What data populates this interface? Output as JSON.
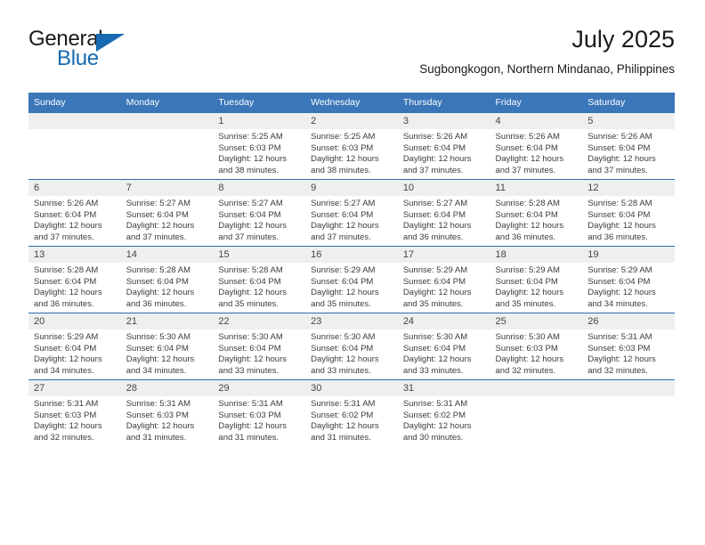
{
  "brand": {
    "name_part1": "General",
    "name_part2": "Blue",
    "logo_icon": "triangle-flag-icon"
  },
  "header": {
    "title": "July 2025",
    "subtitle": "Sugbongkogon, Northern Mindanao, Philippines"
  },
  "colors": {
    "header_blue": "#3a76b8",
    "row_divider_blue": "#2f6cb0",
    "date_band_gray": "#efefef",
    "brand_blue": "#1769b0",
    "text": "#333333"
  },
  "weekday_headers": [
    "Sunday",
    "Monday",
    "Tuesday",
    "Wednesday",
    "Thursday",
    "Friday",
    "Saturday"
  ],
  "weeks": [
    [
      {
        "day": "",
        "sunrise": "",
        "sunset": "",
        "daylight": ""
      },
      {
        "day": "",
        "sunrise": "",
        "sunset": "",
        "daylight": ""
      },
      {
        "day": "1",
        "sunrise": "Sunrise: 5:25 AM",
        "sunset": "Sunset: 6:03 PM",
        "daylight": "Daylight: 12 hours and 38 minutes."
      },
      {
        "day": "2",
        "sunrise": "Sunrise: 5:25 AM",
        "sunset": "Sunset: 6:03 PM",
        "daylight": "Daylight: 12 hours and 38 minutes."
      },
      {
        "day": "3",
        "sunrise": "Sunrise: 5:26 AM",
        "sunset": "Sunset: 6:04 PM",
        "daylight": "Daylight: 12 hours and 37 minutes."
      },
      {
        "day": "4",
        "sunrise": "Sunrise: 5:26 AM",
        "sunset": "Sunset: 6:04 PM",
        "daylight": "Daylight: 12 hours and 37 minutes."
      },
      {
        "day": "5",
        "sunrise": "Sunrise: 5:26 AM",
        "sunset": "Sunset: 6:04 PM",
        "daylight": "Daylight: 12 hours and 37 minutes."
      }
    ],
    [
      {
        "day": "6",
        "sunrise": "Sunrise: 5:26 AM",
        "sunset": "Sunset: 6:04 PM",
        "daylight": "Daylight: 12 hours and 37 minutes."
      },
      {
        "day": "7",
        "sunrise": "Sunrise: 5:27 AM",
        "sunset": "Sunset: 6:04 PM",
        "daylight": "Daylight: 12 hours and 37 minutes."
      },
      {
        "day": "8",
        "sunrise": "Sunrise: 5:27 AM",
        "sunset": "Sunset: 6:04 PM",
        "daylight": "Daylight: 12 hours and 37 minutes."
      },
      {
        "day": "9",
        "sunrise": "Sunrise: 5:27 AM",
        "sunset": "Sunset: 6:04 PM",
        "daylight": "Daylight: 12 hours and 37 minutes."
      },
      {
        "day": "10",
        "sunrise": "Sunrise: 5:27 AM",
        "sunset": "Sunset: 6:04 PM",
        "daylight": "Daylight: 12 hours and 36 minutes."
      },
      {
        "day": "11",
        "sunrise": "Sunrise: 5:28 AM",
        "sunset": "Sunset: 6:04 PM",
        "daylight": "Daylight: 12 hours and 36 minutes."
      },
      {
        "day": "12",
        "sunrise": "Sunrise: 5:28 AM",
        "sunset": "Sunset: 6:04 PM",
        "daylight": "Daylight: 12 hours and 36 minutes."
      }
    ],
    [
      {
        "day": "13",
        "sunrise": "Sunrise: 5:28 AM",
        "sunset": "Sunset: 6:04 PM",
        "daylight": "Daylight: 12 hours and 36 minutes."
      },
      {
        "day": "14",
        "sunrise": "Sunrise: 5:28 AM",
        "sunset": "Sunset: 6:04 PM",
        "daylight": "Daylight: 12 hours and 36 minutes."
      },
      {
        "day": "15",
        "sunrise": "Sunrise: 5:28 AM",
        "sunset": "Sunset: 6:04 PM",
        "daylight": "Daylight: 12 hours and 35 minutes."
      },
      {
        "day": "16",
        "sunrise": "Sunrise: 5:29 AM",
        "sunset": "Sunset: 6:04 PM",
        "daylight": "Daylight: 12 hours and 35 minutes."
      },
      {
        "day": "17",
        "sunrise": "Sunrise: 5:29 AM",
        "sunset": "Sunset: 6:04 PM",
        "daylight": "Daylight: 12 hours and 35 minutes."
      },
      {
        "day": "18",
        "sunrise": "Sunrise: 5:29 AM",
        "sunset": "Sunset: 6:04 PM",
        "daylight": "Daylight: 12 hours and 35 minutes."
      },
      {
        "day": "19",
        "sunrise": "Sunrise: 5:29 AM",
        "sunset": "Sunset: 6:04 PM",
        "daylight": "Daylight: 12 hours and 34 minutes."
      }
    ],
    [
      {
        "day": "20",
        "sunrise": "Sunrise: 5:29 AM",
        "sunset": "Sunset: 6:04 PM",
        "daylight": "Daylight: 12 hours and 34 minutes."
      },
      {
        "day": "21",
        "sunrise": "Sunrise: 5:30 AM",
        "sunset": "Sunset: 6:04 PM",
        "daylight": "Daylight: 12 hours and 34 minutes."
      },
      {
        "day": "22",
        "sunrise": "Sunrise: 5:30 AM",
        "sunset": "Sunset: 6:04 PM",
        "daylight": "Daylight: 12 hours and 33 minutes."
      },
      {
        "day": "23",
        "sunrise": "Sunrise: 5:30 AM",
        "sunset": "Sunset: 6:04 PM",
        "daylight": "Daylight: 12 hours and 33 minutes."
      },
      {
        "day": "24",
        "sunrise": "Sunrise: 5:30 AM",
        "sunset": "Sunset: 6:04 PM",
        "daylight": "Daylight: 12 hours and 33 minutes."
      },
      {
        "day": "25",
        "sunrise": "Sunrise: 5:30 AM",
        "sunset": "Sunset: 6:03 PM",
        "daylight": "Daylight: 12 hours and 32 minutes."
      },
      {
        "day": "26",
        "sunrise": "Sunrise: 5:31 AM",
        "sunset": "Sunset: 6:03 PM",
        "daylight": "Daylight: 12 hours and 32 minutes."
      }
    ],
    [
      {
        "day": "27",
        "sunrise": "Sunrise: 5:31 AM",
        "sunset": "Sunset: 6:03 PM",
        "daylight": "Daylight: 12 hours and 32 minutes."
      },
      {
        "day": "28",
        "sunrise": "Sunrise: 5:31 AM",
        "sunset": "Sunset: 6:03 PM",
        "daylight": "Daylight: 12 hours and 31 minutes."
      },
      {
        "day": "29",
        "sunrise": "Sunrise: 5:31 AM",
        "sunset": "Sunset: 6:03 PM",
        "daylight": "Daylight: 12 hours and 31 minutes."
      },
      {
        "day": "30",
        "sunrise": "Sunrise: 5:31 AM",
        "sunset": "Sunset: 6:02 PM",
        "daylight": "Daylight: 12 hours and 31 minutes."
      },
      {
        "day": "31",
        "sunrise": "Sunrise: 5:31 AM",
        "sunset": "Sunset: 6:02 PM",
        "daylight": "Daylight: 12 hours and 30 minutes."
      },
      {
        "day": "",
        "sunrise": "",
        "sunset": "",
        "daylight": ""
      },
      {
        "day": "",
        "sunrise": "",
        "sunset": "",
        "daylight": ""
      }
    ]
  ]
}
